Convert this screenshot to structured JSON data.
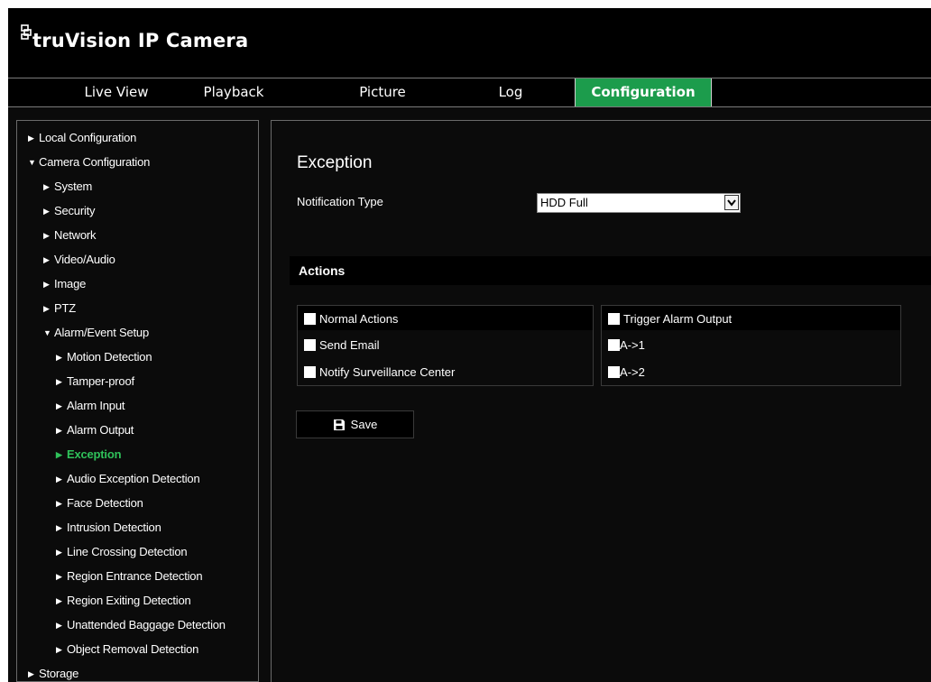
{
  "app": {
    "title": "truVision  IP Camera"
  },
  "nav": {
    "tabs": [
      {
        "label": "Live View"
      },
      {
        "label": "Playback"
      },
      {
        "label": "Picture"
      },
      {
        "label": "Log"
      },
      {
        "label": "Configuration",
        "active": true
      }
    ]
  },
  "sidebar": {
    "items": [
      {
        "label": "Local Configuration",
        "expanded": false
      },
      {
        "label": "Camera Configuration",
        "expanded": true
      },
      {
        "label": "System",
        "expanded": false
      },
      {
        "label": "Security",
        "expanded": false
      },
      {
        "label": "Network",
        "expanded": false
      },
      {
        "label": "Video/Audio",
        "expanded": false
      },
      {
        "label": "Image",
        "expanded": false
      },
      {
        "label": "PTZ",
        "expanded": false
      },
      {
        "label": "Alarm/Event Setup",
        "expanded": true
      },
      {
        "label": "Motion Detection",
        "expanded": false
      },
      {
        "label": "Tamper-proof",
        "expanded": false
      },
      {
        "label": "Alarm Input",
        "expanded": false
      },
      {
        "label": "Alarm Output",
        "expanded": false
      },
      {
        "label": "Exception",
        "expanded": false,
        "selected": true
      },
      {
        "label": "Audio Exception Detection",
        "expanded": false
      },
      {
        "label": "Face Detection",
        "expanded": false
      },
      {
        "label": "Intrusion Detection",
        "expanded": false
      },
      {
        "label": "Line Crossing Detection",
        "expanded": false
      },
      {
        "label": "Region Entrance Detection",
        "expanded": false
      },
      {
        "label": "Region Exiting Detection",
        "expanded": false
      },
      {
        "label": "Unattended Baggage Detection",
        "expanded": false
      },
      {
        "label": "Object Removal Detection",
        "expanded": false
      },
      {
        "label": "Storage",
        "expanded": false
      }
    ]
  },
  "main": {
    "title": "Exception",
    "notification_type_label": "Notification Type",
    "notification_type_value": "HDD Full",
    "actions_heading": "Actions",
    "normal_actions": {
      "header": "Normal Actions",
      "options": [
        {
          "label": "Send Email",
          "checked": false
        },
        {
          "label": "Notify Surveillance Center",
          "checked": false
        }
      ]
    },
    "trigger_alarm": {
      "header": "Trigger Alarm Output",
      "options": [
        {
          "label": "A->1",
          "checked": false
        },
        {
          "label": "A->2",
          "checked": false
        }
      ]
    },
    "save_label": "Save"
  },
  "colors": {
    "accent": "#1c9c4c",
    "selected_text": "#2fc15a",
    "background": "#0b0b0b"
  }
}
